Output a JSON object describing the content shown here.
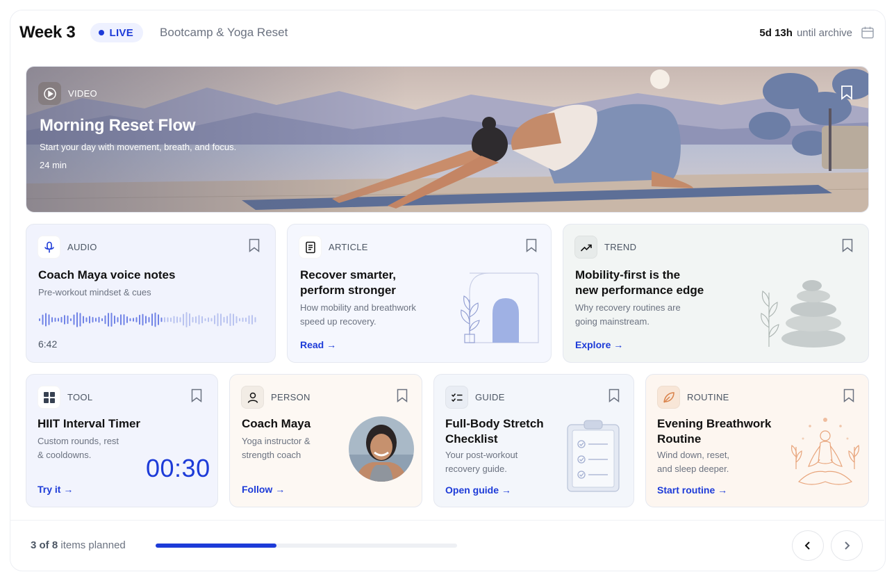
{
  "header": {
    "week": "Week 3",
    "live_label": "LIVE",
    "program": "Bootcamp & Yoga Reset",
    "archive_time": "5d 13h",
    "archive_suffix": "until archive"
  },
  "hero": {
    "type": "VIDEO",
    "title": "Morning Reset Flow",
    "subtitle": "Start your day with movement, breath, and focus.",
    "duration": "24 min"
  },
  "cards": {
    "audio": {
      "type": "AUDIO",
      "title": "Coach Maya voice notes",
      "desc": "Pre-workout mindset & cues",
      "duration": "6:42"
    },
    "article": {
      "type": "ARTICLE",
      "title_1": "Recover smarter,",
      "title_2": "perform stronger",
      "desc_1": "How mobility and breathwork",
      "desc_2": "speed up recovery.",
      "cta": "Read →"
    },
    "trend": {
      "type": "TREND",
      "title_1": "Mobility-first is the",
      "title_2": "new performance edge",
      "desc_1": "Why recovery routines are",
      "desc_2": "going mainstream.",
      "cta": "Explore →"
    },
    "tool": {
      "type": "TOOL",
      "title": "HIIT Interval Timer",
      "desc_1": "Custom rounds, rest",
      "desc_2": "& cooldowns.",
      "timer": "00:30",
      "cta": "Try it →"
    },
    "person": {
      "type": "PERSON",
      "title": "Coach Maya",
      "desc_1": "Yoga instructor &",
      "desc_2": "strength coach",
      "cta": "Follow →"
    },
    "guide": {
      "type": "GUIDE",
      "title_1": "Full-Body Stretch",
      "title_2": "Checklist",
      "desc_1": "Your post-workout",
      "desc_2": "recovery guide.",
      "cta": "Open guide →"
    },
    "routine": {
      "type": "ROUTINE",
      "title_1": "Evening Breathwork",
      "title_2": "Routine",
      "desc_1": "Wind down, reset,",
      "desc_2": "and sleep deeper.",
      "cta": "Start routine →"
    }
  },
  "footer": {
    "planned_count": "3",
    "planned_of": "of",
    "planned_total": "8",
    "planned_suffix": "items planned",
    "progress_fraction": 0.4
  },
  "colors": {
    "accent": "#1d3bd8",
    "live_bg": "#eef1ff",
    "audio_bg": "#f1f3fd",
    "article_bg": "#f5f7fe",
    "trend_bg": "#f2f5f4",
    "tool_bg": "#f2f4fd",
    "person_bg": "#fdf8f3",
    "guide_bg": "#f3f6fb",
    "routine_bg": "#fdf6f0"
  },
  "icons": [
    "calendar-icon",
    "play-icon",
    "bookmark-icon",
    "microphone-icon",
    "document-icon",
    "trend-up-icon",
    "grid-icon",
    "person-icon",
    "checklist-icon",
    "leaf-icon",
    "chevron-left-icon",
    "chevron-right-icon"
  ]
}
